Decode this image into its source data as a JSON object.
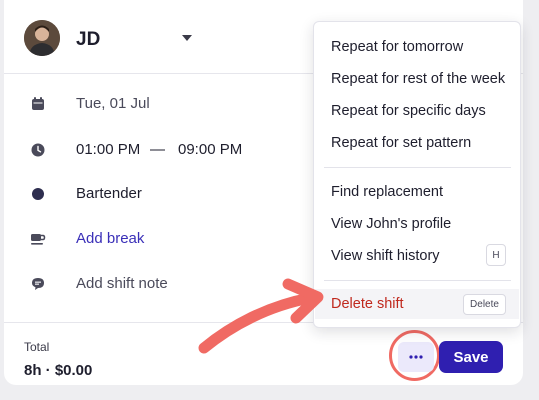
{
  "header": {
    "name": "JD",
    "avatar_icon": "person-avatar"
  },
  "details": {
    "date": "Tue, 01 Jul",
    "start_time": "01:00 PM",
    "separator": "—",
    "end_time": "09:00 PM",
    "role": "Bartender",
    "role_color": "#2e2e4f",
    "add_break": "Add break",
    "add_note": "Add shift note"
  },
  "footer": {
    "total_label": "Total",
    "total_value": "8h · $0.00",
    "more_label": "···",
    "save_label": "Save"
  },
  "menu": {
    "items": [
      {
        "label": "Repeat for tomorrow"
      },
      {
        "label": "Repeat for rest of the week"
      },
      {
        "label": "Repeat for specific days"
      },
      {
        "label": "Repeat for set pattern"
      },
      {
        "label": "Find replacement"
      },
      {
        "label": "View John's profile"
      },
      {
        "label": "View shift history",
        "shortcut": "H"
      },
      {
        "label": "Delete shift",
        "shortcut": "Delete"
      }
    ]
  },
  "colors": {
    "accent": "#2f1fb0",
    "danger": "#c0281d",
    "annotation": "#f06a63"
  }
}
